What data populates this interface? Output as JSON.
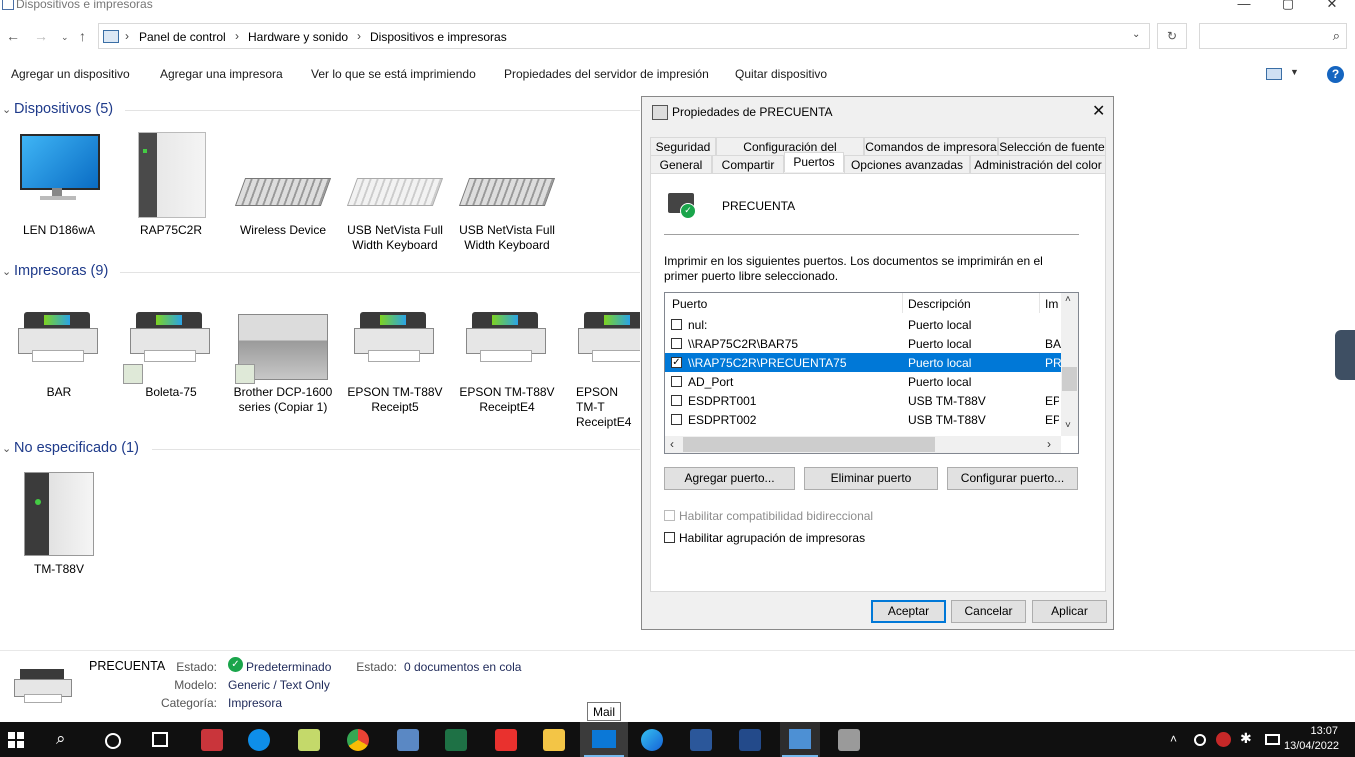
{
  "window": {
    "title": "Dispositivos e impresoras"
  },
  "address": {
    "crumbs": [
      "Panel de control",
      "Hardware y sonido",
      "Dispositivos e impresoras"
    ]
  },
  "commands": [
    "Agregar un dispositivo",
    "Agregar una impresora",
    "Ver lo que se está imprimiendo",
    "Propiedades del servidor de impresión",
    "Quitar dispositivo"
  ],
  "groups": {
    "devices": {
      "title": "Dispositivos (5)",
      "items": [
        {
          "label": "LEN D186wA",
          "icon": "monitor-icon"
        },
        {
          "label": "RAP75C2R",
          "icon": "computer-tower-icon"
        },
        {
          "label": "Wireless Device",
          "icon": "keyboard-icon"
        },
        {
          "label": "USB NetVista Full Width Keyboard",
          "icon": "keyboard-icon"
        },
        {
          "label": "USB NetVista Full Width Keyboard",
          "icon": "keyboard-icon"
        }
      ]
    },
    "printers": {
      "title": "Impresoras (9)",
      "items": [
        {
          "label": "BAR",
          "icon": "printer-icon"
        },
        {
          "label": "Boleta-75",
          "icon": "printer-icon"
        },
        {
          "label": "Brother DCP-1600 series (Copiar 1)",
          "icon": "multifunction-printer-icon"
        },
        {
          "label": "EPSON TM-T88V Receipt5",
          "icon": "printer-icon"
        },
        {
          "label": "EPSON TM-T88V ReceiptE4",
          "icon": "printer-icon"
        },
        {
          "label": "EPSON TM-T ReceiptE4",
          "icon": "printer-icon"
        }
      ]
    },
    "unspecified": {
      "title": "No especificado (1)",
      "items": [
        {
          "label": "TM-T88V",
          "icon": "device-box-icon"
        }
      ]
    }
  },
  "dialog": {
    "title": "Propiedades de PRECUENTA",
    "tabs_row1": [
      "Seguridad",
      "Configuración del dispositivo",
      "Comandos de impresora",
      "Selección de fuente"
    ],
    "tabs_row2": [
      "General",
      "Compartir",
      "Puertos",
      "Opciones avanzadas",
      "Administración del color"
    ],
    "active_tab": "Puertos",
    "printer_name": "PRECUENTA",
    "description": "Imprimir en los siguientes puertos. Los documentos se imprimirán en el primer puerto libre seleccionado.",
    "columns": [
      "Puerto",
      "Descripción",
      "Im"
    ],
    "ports": [
      {
        "port": "nul:",
        "desc": "Puerto local",
        "printer": "",
        "checked": false
      },
      {
        "port": "\\\\RAP75C2R\\BAR75",
        "desc": "Puerto local",
        "printer": "BA",
        "checked": false
      },
      {
        "port": "\\\\RAP75C2R\\PRECUENTA75",
        "desc": "Puerto local",
        "printer": "PR",
        "checked": true
      },
      {
        "port": "AD_Port",
        "desc": "Puerto local",
        "printer": "",
        "checked": false
      },
      {
        "port": "ESDPRT001",
        "desc": "USB TM-T88V",
        "printer": "EP",
        "checked": false
      },
      {
        "port": "ESDPRT002",
        "desc": "USB TM-T88V",
        "printer": "EP",
        "checked": false
      }
    ],
    "buttons_ports": [
      "Agregar puerto...",
      "Eliminar puerto",
      "Configurar puerto..."
    ],
    "bidi_label": "Habilitar compatibilidad bidireccional",
    "pool_label": "Habilitar agrupación de impresoras",
    "ok": "Aceptar",
    "cancel": "Cancelar",
    "apply": "Aplicar"
  },
  "status": {
    "name": "PRECUENTA",
    "estado_label": "Estado:",
    "estado_value": "Predeterminado",
    "estado2_label": "Estado:",
    "estado2_value": "0 documentos en cola",
    "modelo_label": "Modelo:",
    "modelo_value": "Generic / Text Only",
    "categoria_label": "Categoría:",
    "categoria_value": "Impresora"
  },
  "tooltip": "Mail",
  "clock": {
    "time": "13:07",
    "date": "13/04/2022"
  },
  "colors": {
    "accent": "#0078d7",
    "group_header": "#1e3a8a",
    "taskbar": "#101010"
  }
}
